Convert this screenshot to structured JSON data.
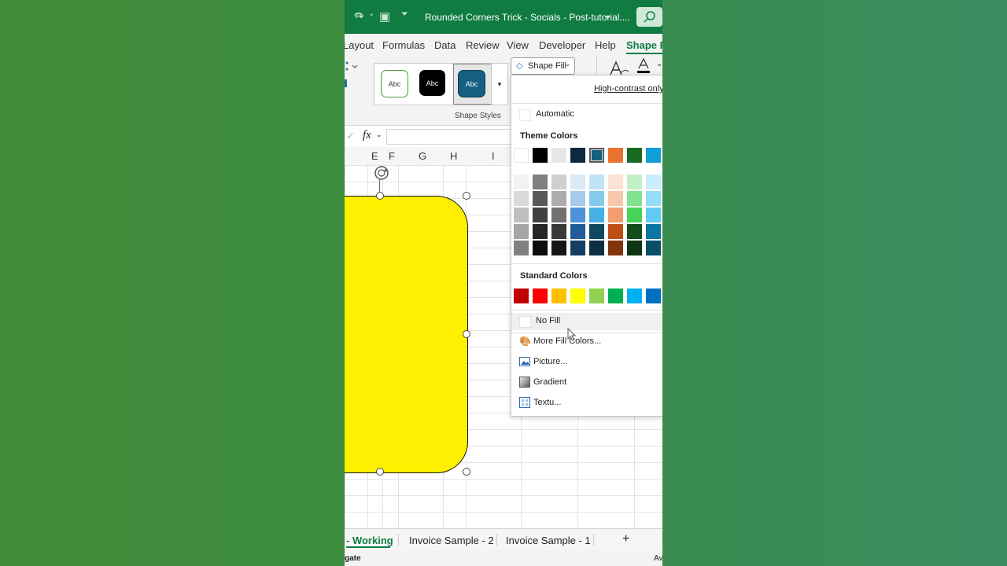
{
  "titlebar": {
    "title": "Rounded Corners Trick - Socials - Post-tutorial....",
    "icons": [
      "redo-icon",
      "screen-icon",
      "customize-icon",
      "chevron-down-icon",
      "search-icon"
    ]
  },
  "menu": {
    "items": [
      "Layout",
      "Formulas",
      "Data",
      "Review",
      "View",
      "Developer",
      "Help",
      "Shape Format"
    ],
    "active": "Shape Format"
  },
  "ribbon": {
    "styles": [
      "Abc",
      "Abc",
      "Abc"
    ],
    "group_label": "Shape Styles",
    "shape_fill_label": "Shape Fill"
  },
  "formula_bar": {
    "fx": "fx"
  },
  "columns": [
    "E",
    "F",
    "G",
    "H",
    "I"
  ],
  "fill_menu": {
    "high_contrast": "High-contrast only",
    "automatic": "Automatic",
    "theme_heading": "Theme Colors",
    "theme_row": [
      "#ffffff",
      "#000000",
      "#e7e6e6",
      "#0e2841",
      "#156082",
      "#e97132",
      "#196b24",
      "#0f9ed5"
    ],
    "theme_shades": [
      [
        "#f2f2f2",
        "#d9d9d9",
        "#bfbfbf",
        "#a6a6a6",
        "#808080"
      ],
      [
        "#7f7f7f",
        "#595959",
        "#404040",
        "#262626",
        "#0d0d0d"
      ],
      [
        "#d0cece",
        "#aeabab",
        "#757171",
        "#3a3838",
        "#171616"
      ],
      [
        "#dae9f8",
        "#a6c9ec",
        "#4d93d9",
        "#215c98",
        "#163e64"
      ],
      [
        "#c0e4f5",
        "#83cbeb",
        "#45b0e1",
        "#104862",
        "#0b3041"
      ],
      [
        "#fbe2d5",
        "#f7c7ac",
        "#f19d6f",
        "#c04f15",
        "#80350e"
      ],
      [
        "#c1f0c8",
        "#83e28e",
        "#47d359",
        "#124f1b",
        "#0c3512"
      ],
      [
        "#caedfb",
        "#95dcf7",
        "#61cbf3",
        "#0b76a0",
        "#074f69"
      ]
    ],
    "standard_heading": "Standard Colors",
    "standard_colors": [
      "#c00000",
      "#ff0000",
      "#ffc000",
      "#ffff00",
      "#92d050",
      "#00b050",
      "#00b0f0",
      "#0070c0"
    ],
    "no_fill": "No Fill",
    "more_colors": "More Fill Colors...",
    "picture": "Picture...",
    "gradient": "Gradient",
    "texture": "Textu..."
  },
  "sheet_tabs": {
    "active": "- Working",
    "tabs": [
      "Invoice Sample - 2",
      "Invoice Sample - 1"
    ],
    "add": "+"
  },
  "status": {
    "left": "gate",
    "right": "Av"
  },
  "shape": {
    "fill": "#ffef00"
  }
}
